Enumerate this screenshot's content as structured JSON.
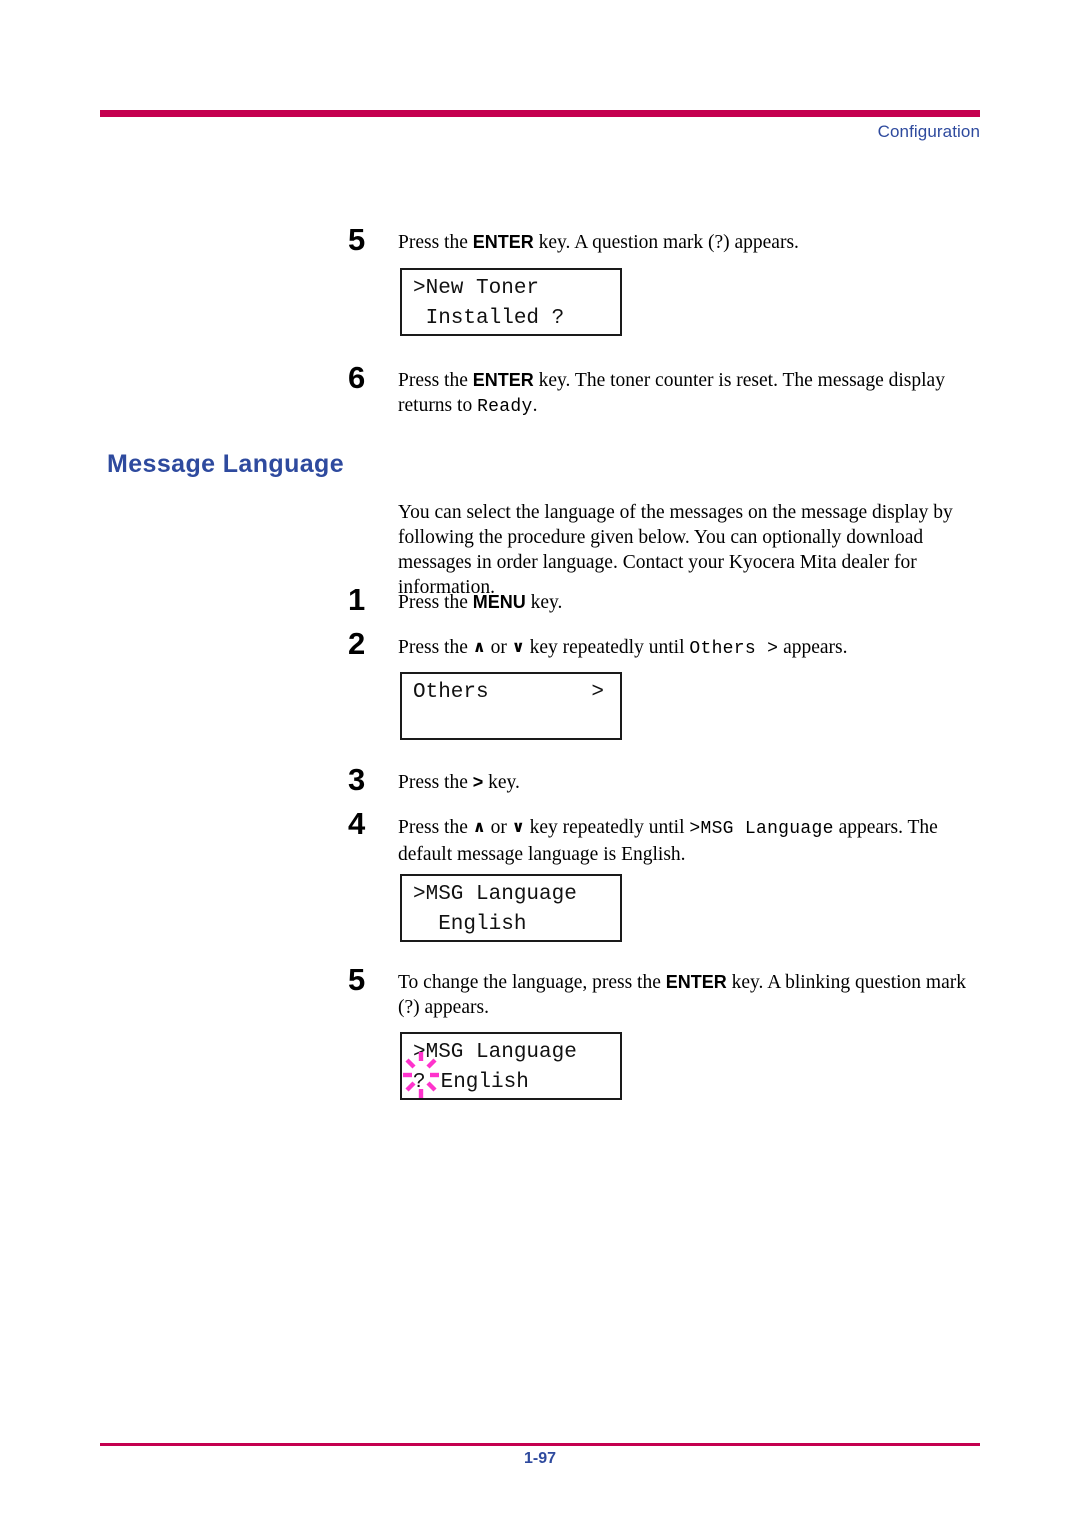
{
  "page": {
    "header_label": "Configuration",
    "page_number": "1-97",
    "rule_color": "#C4004F",
    "accent_color": "#2E4A9E",
    "blink_color": "#FF33CC"
  },
  "top_steps": [
    {
      "number": "5",
      "text_before": "Press the ",
      "key": "ENTER",
      "text_after": " key. A question mark (?) appears."
    },
    {
      "number": "6",
      "text_before": "Press the ",
      "key": "ENTER",
      "text_mid": " key. The toner counter is reset. The message display returns to ",
      "mono": "Ready",
      "text_after": "."
    }
  ],
  "lcd_toner": {
    "name": "new-toner-installed",
    "line1": ">New Toner",
    "line2": " Installed ?"
  },
  "section": {
    "heading": "Message Language",
    "paragraph": "You can select the language of the messages on the message display by following the procedure given below. You can optionally download messages in order language. Contact your Kyocera Mita dealer for information."
  },
  "steps": [
    {
      "number": "1",
      "text_before": "Press the ",
      "key": "MENU",
      "text_after": " key."
    },
    {
      "number": "2",
      "text_before": "Press the ",
      "up": "∧",
      "or": " or ",
      "down": "∨",
      "text_mid": " key repeatedly until ",
      "mono": "Others >",
      "text_after": " appears."
    },
    {
      "number": "3",
      "text_before": "Press the ",
      "key": ">",
      "text_after": " key."
    },
    {
      "number": "4",
      "text_before": "Press the ",
      "up": "∧",
      "or": " or ",
      "down": "∨",
      "text_mid": " key repeatedly until ",
      "mono": ">MSG Language",
      "text_after": " appears. The default message language is English."
    },
    {
      "number": "5",
      "text_before": "To change the language, press the ",
      "key": "ENTER",
      "text_after": " key. A blinking question mark (?) appears."
    }
  ],
  "lcd_others": {
    "name": "others-menu",
    "line1": "Others",
    "line1_right": ">",
    "line2": ""
  },
  "lcd_msg_language": {
    "name": "msg-language-english",
    "line1": ">MSG Language",
    "line2": "  English"
  },
  "lcd_msg_language_blink": {
    "name": "msg-language-blinking",
    "line1": ">MSG Language",
    "blink_char": "?",
    "line2_rest": " English"
  }
}
